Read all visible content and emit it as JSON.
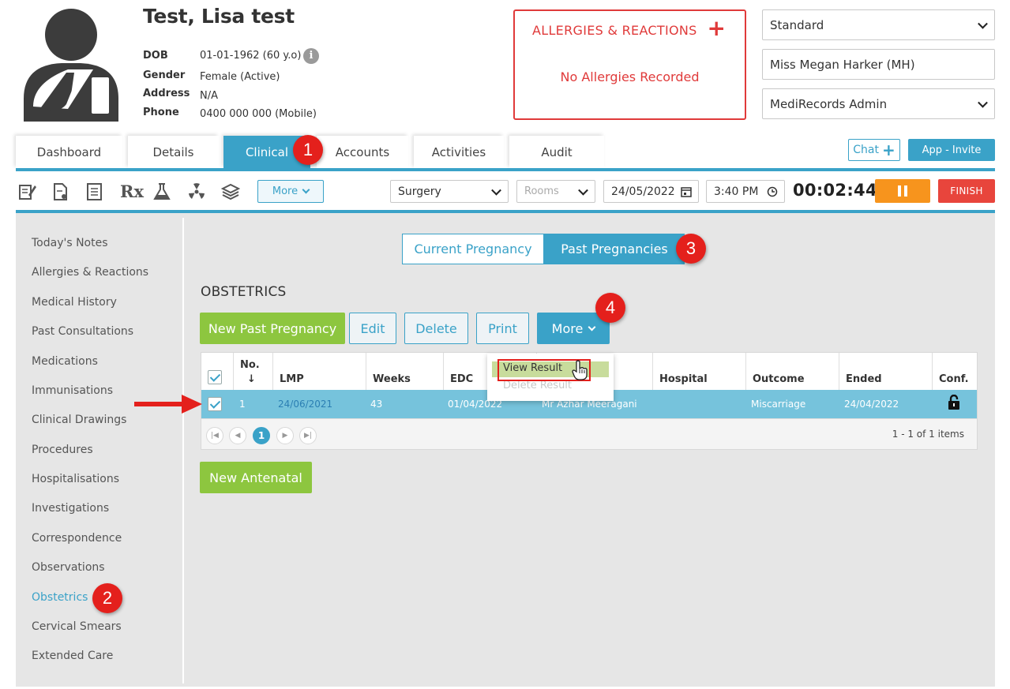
{
  "patient": {
    "name": "Test, Lisa test",
    "dob_label": "DOB",
    "dob": "01-01-1962 (60 y.o)",
    "gender_label": "Gender",
    "gender": "Female (Active)",
    "address_label": "Address",
    "address": "N/A",
    "phone_label": "Phone",
    "phone": "0400 000 000 (Mobile)"
  },
  "allergies": {
    "title": "ALLERGIES & REACTIONS",
    "add": "+",
    "status": "No Allergies Recorded"
  },
  "selectors": {
    "view": "Standard",
    "practitioner": "Miss Megan Harker (MH)",
    "role": "MediRecords Admin"
  },
  "tabs": [
    {
      "label": "Dashboard"
    },
    {
      "label": "Details"
    },
    {
      "label": "Clinical"
    },
    {
      "label": "Accounts"
    },
    {
      "label": "Activities"
    },
    {
      "label": "Audit"
    }
  ],
  "header_buttons": {
    "chat": "Chat",
    "chat_plus": "+",
    "app_invite": "App - Invite"
  },
  "toolbar": {
    "icons": [
      "notes-icon",
      "document-icon",
      "checklist-icon",
      "prescription-icon",
      "lab-flask-icon",
      "radiation-icon",
      "stack-icon"
    ],
    "rx": "Rx",
    "more": "More",
    "location": "Surgery",
    "rooms_placeholder": "Rooms",
    "date": "24/05/2022",
    "time": "3:40 PM",
    "timer": "00:02:44",
    "finish": "FINISH"
  },
  "sidebar": [
    "Today's Notes",
    "Allergies & Reactions",
    "Medical History",
    "Past Consultations",
    "Medications",
    "Immunisations",
    "Clinical Drawings",
    "Procedures",
    "Hospitalisations",
    "Investigations",
    "Correspondence",
    "Observations",
    "Obstetrics",
    "Cervical Smears",
    "Extended Care"
  ],
  "sidebar_active": "Obstetrics",
  "pregnancy_toggle": {
    "current": "Current Pregnancy",
    "past": "Past Pregnancies",
    "selected": "past"
  },
  "section_title": "OBSTETRICS",
  "actions": {
    "new": "New Past Pregnancy",
    "edit": "Edit",
    "delete": "Delete",
    "print": "Print",
    "more": "More"
  },
  "more_menu": {
    "view_result": "View Result",
    "delete_result": "Delete Result"
  },
  "table": {
    "columns": [
      "No.",
      "↓",
      "LMP",
      "Weeks",
      "EDC",
      "Hospital",
      "Outcome",
      "Ended",
      "Conf."
    ],
    "rows": [
      {
        "no": "1",
        "lmp": "24/06/2021",
        "weeks": "43",
        "edc": "01/04/2022",
        "practitioner": "Mr Azhar Meeragani",
        "hospital": "",
        "outcome": "Miscarriage",
        "ended": "24/04/2022",
        "conf": "unlocked"
      }
    ],
    "pager": {
      "current_page": "1",
      "info": "1 - 1 of 1 items"
    }
  },
  "new_antenatal": "New Antenatal",
  "callouts": [
    "1",
    "2",
    "3",
    "4"
  ],
  "colors": {
    "accent": "#3aa2c8",
    "green": "#8dc63f",
    "alert": "#e03a3a",
    "pause": "#f7941d",
    "finish": "#e8453c",
    "badge": "#e4201c"
  }
}
